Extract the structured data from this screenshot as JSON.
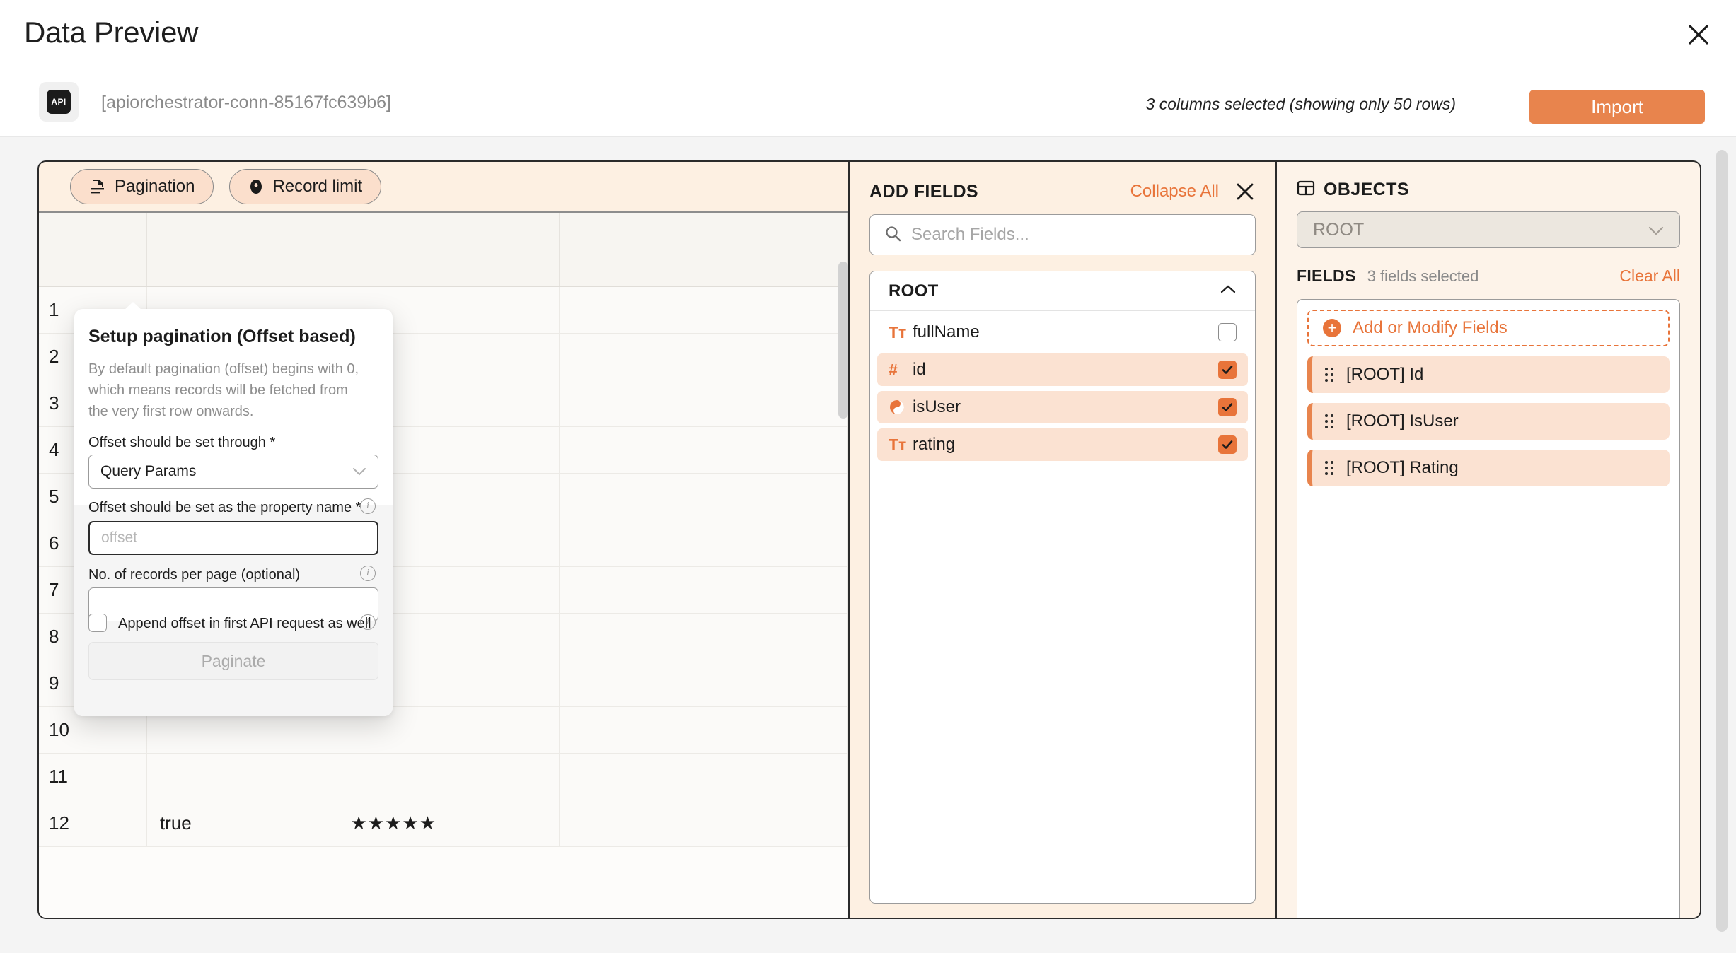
{
  "header": {
    "title": "Data Preview",
    "close_icon": "close-icon"
  },
  "subheader": {
    "source_badge": "API",
    "connection_name": "[apiorchestrator-conn-85167fc639b6]",
    "columns_note": "3 columns selected (showing only 50 rows)",
    "import_label": "Import"
  },
  "toolbar": {
    "pagination_label": "Pagination",
    "record_limit_label": "Record limit"
  },
  "pagination_popover": {
    "title": "Setup pagination (Offset based)",
    "description": "By default pagination (offset) begins with 0, which means records will be fetched from the very first row onwards.",
    "offset_through_label": "Offset should be set through *",
    "offset_through_value": "Query Params",
    "property_name_label": "Offset should be set as the property name *",
    "property_name_value": "",
    "property_name_placeholder": "offset",
    "records_per_page_label": "No. of records per page (optional)",
    "records_per_page_value": "",
    "records_per_page_placeholder": "",
    "append_offset_label": "Append offset in first API request as well",
    "append_offset_checked": false,
    "paginate_label": "Paginate"
  },
  "table": {
    "rows": [
      {
        "idx": "1",
        "b": "",
        "c": "",
        "d": ""
      },
      {
        "idx": "2",
        "b": "",
        "c": "",
        "d": ""
      },
      {
        "idx": "3",
        "b": "",
        "c": "",
        "d": ""
      },
      {
        "idx": "4",
        "b": "",
        "c": "",
        "d": ""
      },
      {
        "idx": "5",
        "b": "",
        "c": "",
        "d": ""
      },
      {
        "idx": "6",
        "b": "",
        "c": "",
        "d": ""
      },
      {
        "idx": "7",
        "b": "",
        "c": "",
        "d": ""
      },
      {
        "idx": "8",
        "b": "",
        "c": "",
        "d": ""
      },
      {
        "idx": "9",
        "b": "",
        "c": "",
        "d": ""
      },
      {
        "idx": "10",
        "b": "",
        "c": "",
        "d": ""
      },
      {
        "idx": "11",
        "b": "",
        "c": "",
        "d": ""
      },
      {
        "idx": "12",
        "b": "true",
        "c": "★★★★★",
        "d": ""
      }
    ]
  },
  "add_fields": {
    "title": "ADD FIELDS",
    "collapse_all": "Collapse All",
    "search_placeholder": "Search Fields...",
    "search_value": "",
    "group_name": "ROOT",
    "fields": [
      {
        "name": "fullName",
        "type_glyph": "Tт",
        "type": "text",
        "selected": false
      },
      {
        "name": "id",
        "type_glyph": "#",
        "type": "number",
        "selected": true
      },
      {
        "name": "isUser",
        "type_glyph": "☯",
        "type": "boolean",
        "selected": true
      },
      {
        "name": "rating",
        "type_glyph": "Tт",
        "type": "text",
        "selected": true
      }
    ]
  },
  "objects": {
    "title": "OBJECTS",
    "selected_object": "ROOT",
    "fields_label": "FIELDS",
    "fields_count_text": "3 fields selected",
    "clear_all": "Clear All",
    "add_or_modify_label": "Add or Modify Fields",
    "chips": [
      {
        "label": "[ROOT] Id"
      },
      {
        "label": "[ROOT] IsUser"
      },
      {
        "label": "[ROOT] Rating"
      }
    ]
  },
  "colors": {
    "accent": "#e8743a",
    "accent_button": "#e8844d",
    "panel_bg": "#fdf3e9",
    "row_selected": "#fbe2d2"
  }
}
